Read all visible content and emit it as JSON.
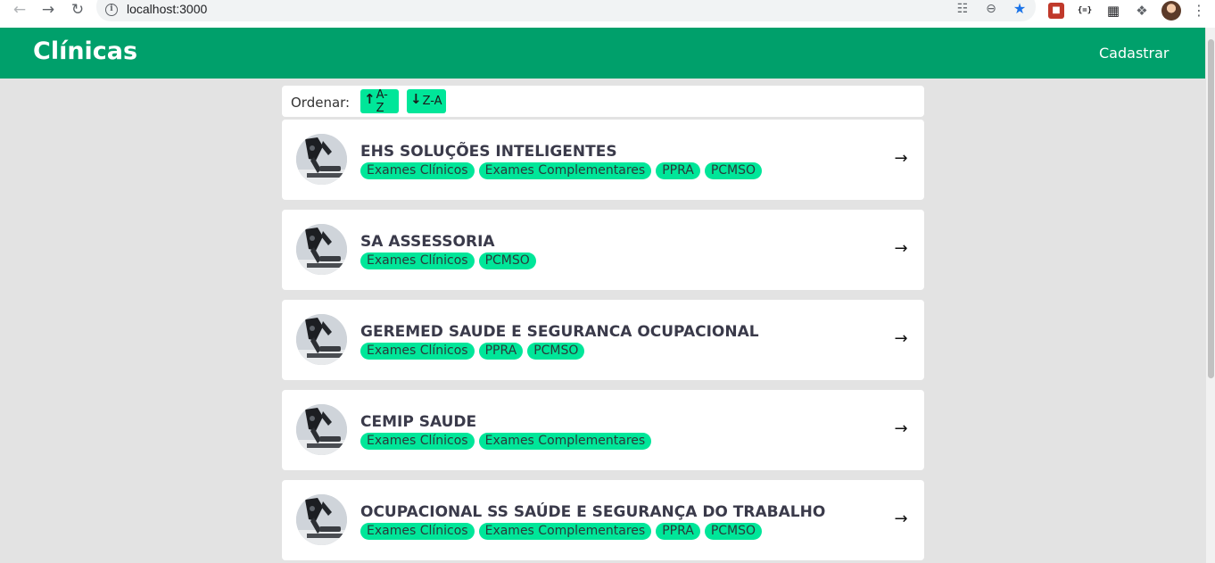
{
  "browser": {
    "url": "localhost:3000"
  },
  "header": {
    "title": "Clínicas",
    "register_label": "Cadastrar"
  },
  "sort": {
    "label": "Ordenar:",
    "az_label": "A-Z",
    "za_label": "Z-A"
  },
  "clinics": [
    {
      "name": "EHS SOLUÇÕES INTELIGENTES",
      "tags": [
        "Exames Clínicos",
        "Exames Complementares",
        "PPRA",
        "PCMSO"
      ]
    },
    {
      "name": "SA ASSESSORIA",
      "tags": [
        "Exames Clínicos",
        "PCMSO"
      ]
    },
    {
      "name": "GEREMED SAUDE E SEGURANCA OCUPACIONAL",
      "tags": [
        "Exames Clínicos",
        "PPRA",
        "PCMSO"
      ]
    },
    {
      "name": "CEMIP SAUDE",
      "tags": [
        "Exames Clínicos",
        "Exames Complementares"
      ]
    },
    {
      "name": "OCUPACIONAL SS SAÚDE E SEGURANÇA DO TRABALHO",
      "tags": [
        "Exames Clínicos",
        "Exames Complementares",
        "PPRA",
        "PCMSO"
      ]
    }
  ],
  "colors": {
    "header_bg": "#00a06b",
    "tag_bg": "#00e699",
    "page_bg": "#e3e3e3"
  }
}
